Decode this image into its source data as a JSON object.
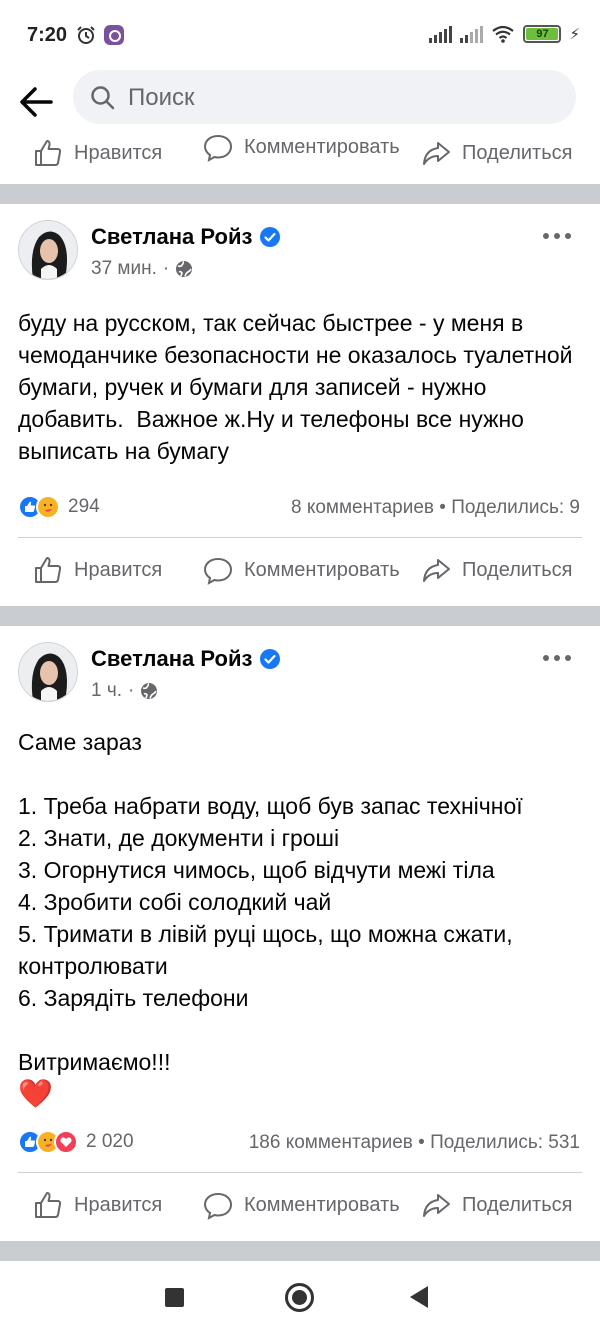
{
  "status_bar": {
    "time": "7:20",
    "battery": "97",
    "icons": [
      "alarm-icon",
      "viber-icon",
      "signal-icon",
      "signal-icon",
      "wifi-icon",
      "battery-icon",
      "charging-icon"
    ]
  },
  "header": {
    "search_placeholder": "Поиск"
  },
  "actions": {
    "like": "Нравится",
    "comment": "Комментировать",
    "share": "Поделиться"
  },
  "posts": [
    {
      "author": "Светлана Ройз",
      "time": "37 мин.",
      "text": "буду на русском, так сейчас быстрее - у меня в чемоданчике безопасности не оказалось туалетной бумаги, ручек и бумаги для записей - нужно добавить.  Важное ж.Ну и телефоны все нужно выписать на бумагу",
      "reactions_count": "294",
      "comments": "8 комментариев",
      "shares": "Поделились: 9",
      "stats_separator": " • "
    },
    {
      "author": "Светлана Ройз",
      "time": "1 ч.",
      "text": "Саме зараз\n\n1. Треба набрати воду, щоб був запас технічної\n2. Знати, де документи і гроші\n3. Огорнутися чимось, щоб відчути межі тіла\n4. Зробити собі солодкий чай\n5. Тримати в лівій руці щось, що можна сжати, контролювати\n6. Зарядіть телефони\n\nВитримаємо!!!",
      "emoji": "❤️",
      "reactions_count": "2 020",
      "comments": "186 комментариев",
      "shares": "Поделились: 531",
      "stats_separator": " • "
    }
  ],
  "colors": {
    "brand_blue": "#1877f2",
    "secondary_text": "#65676b",
    "separator": "#c9ccd1"
  }
}
